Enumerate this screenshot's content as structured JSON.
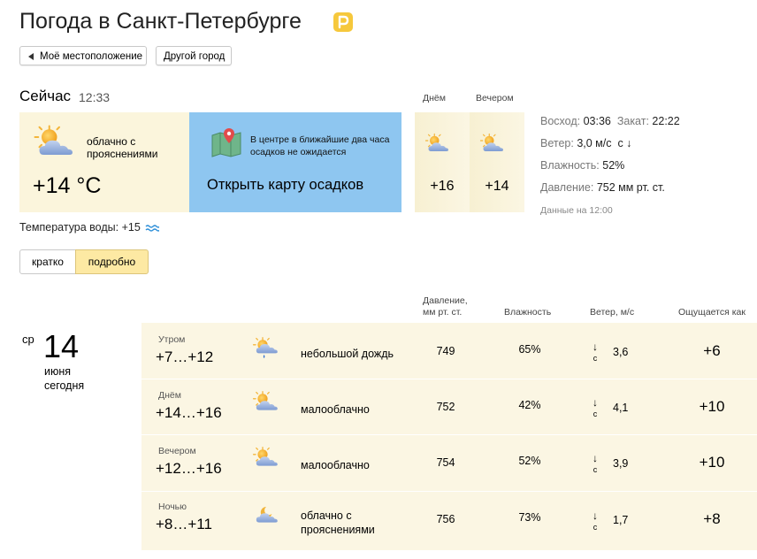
{
  "header": {
    "title": "Погода в Санкт-Петербурге"
  },
  "buttons": {
    "my_location": "Моё местоположение",
    "other_city": "Другой город"
  },
  "now": {
    "label": "Сейчас",
    "time": "12:33",
    "condition": "облачно с прояснениями",
    "temp": "+14 °C",
    "icon": "partly-cloudy-icon",
    "map_text": "В центре в ближайшие два часа осадков не ожидается",
    "map_link": "Открыть карту осадков",
    "day_label": "Днём",
    "day_temp": "+16",
    "evening_label": "Вечером",
    "evening_temp": "+14"
  },
  "info": {
    "sunrise_label": "Восход:",
    "sunrise": "03:36",
    "sunset_label": "Закат:",
    "sunset": "22:22",
    "wind_label": "Ветер:",
    "wind": "3,0 м/с",
    "wind_dir": "с ↓",
    "humidity_label": "Влажность:",
    "humidity": "52%",
    "pressure_label": "Давление:",
    "pressure": "752 мм рт. ст.",
    "data_at": "Данные на 12:00"
  },
  "water": {
    "label": "Температура воды: +15"
  },
  "view": {
    "brief": "кратко",
    "detailed": "подробно",
    "selected": "подробно"
  },
  "table": {
    "headers": {
      "pressure": "Давление, мм рт. ст.",
      "humidity": "Влажность",
      "wind": "Ветер, м/с",
      "feels": "Ощущается как"
    },
    "day": {
      "dow": "ср",
      "num": "14",
      "month": "июня",
      "relative": "сегодня"
    },
    "rows": [
      {
        "period": "Утром",
        "range": "+7…+12",
        "icon": "rain-icon",
        "cond": "небольшой дождь",
        "pressure": "749",
        "humidity": "65%",
        "wind_arrow": "↓",
        "wind_dir": "с",
        "wind": "3,6",
        "feels": "+6"
      },
      {
        "period": "Днём",
        "range": "+14…+16",
        "icon": "partly-cloudy-icon",
        "cond": "малооблачно",
        "pressure": "752",
        "humidity": "42%",
        "wind_arrow": "↓",
        "wind_dir": "с",
        "wind": "4,1",
        "feels": "+10"
      },
      {
        "period": "Вечером",
        "range": "+12…+16",
        "icon": "partly-cloudy-icon",
        "cond": "малооблачно",
        "pressure": "754",
        "humidity": "52%",
        "wind_arrow": "↓",
        "wind_dir": "с",
        "wind": "3,9",
        "feels": "+10"
      },
      {
        "period": "Ночью",
        "range": "+8…+11",
        "icon": "night-cloudy-icon",
        "cond": "облачно с прояснениями",
        "pressure": "756",
        "humidity": "73%",
        "wind_arrow": "↓",
        "wind_dir": "с",
        "wind": "1,7",
        "feels": "+8"
      }
    ]
  },
  "colors": {
    "card_bg": "#fbf5dc",
    "map_bg": "#8ec6f0",
    "selected_tab": "#fde9a3",
    "row_bg": "#fbf6e3"
  }
}
